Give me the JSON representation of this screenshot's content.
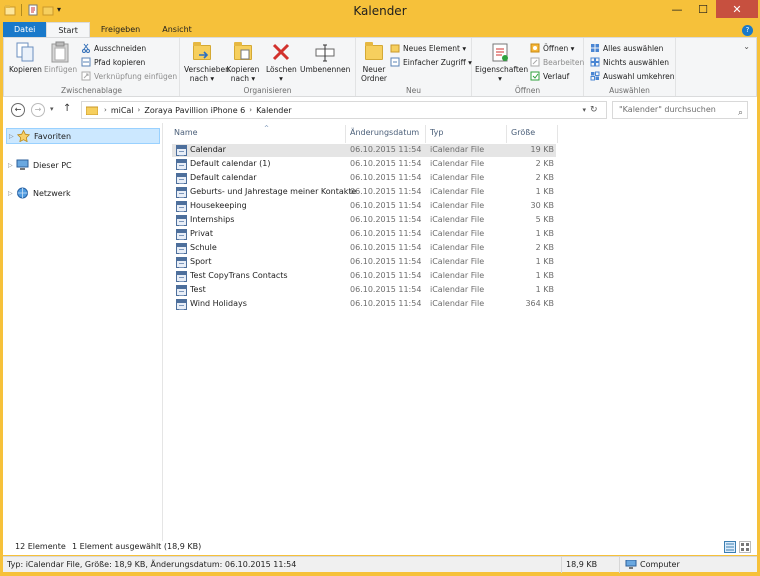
{
  "window": {
    "title": "Kalender",
    "minimize": "—",
    "maximize": "☐",
    "close": "✕"
  },
  "tabs": [
    {
      "label": "Datei"
    },
    {
      "label": "Start"
    },
    {
      "label": "Freigeben"
    },
    {
      "label": "Ansicht"
    }
  ],
  "ribbon": {
    "clipboard": {
      "label": "Zwischenablage",
      "copy": "Kopieren",
      "paste": "Einfügen",
      "cut": "Ausschneiden",
      "copy_path": "Pfad kopieren",
      "paste_shortcut": "Verknüpfung einfügen"
    },
    "organize": {
      "label": "Organisieren",
      "move_to_1": "Verschieben",
      "move_to_2": "nach",
      "copy_to_1": "Kopieren",
      "copy_to_2": "nach",
      "delete": "Löschen",
      "rename": "Umbenennen"
    },
    "new": {
      "label": "Neu",
      "new_folder_1": "Neuer",
      "new_folder_2": "Ordner",
      "new_item": "Neues Element",
      "easy_access": "Einfacher Zugriff"
    },
    "open": {
      "label": "Öffnen",
      "properties": "Eigenschaften",
      "open": "Öffnen",
      "edit": "Bearbeiten",
      "history": "Verlauf"
    },
    "select": {
      "label": "Auswählen",
      "select_all": "Alles auswählen",
      "select_none": "Nichts auswählen",
      "invert": "Auswahl umkehren"
    }
  },
  "address": {
    "crumbs": [
      "miCal",
      "Zoraya Pavillion iPhone 6",
      "Kalender"
    ],
    "search_placeholder": "\"Kalender\" durchsuchen"
  },
  "nav": {
    "items": [
      {
        "label": "Favoriten"
      },
      {
        "label": "Dieser PC"
      },
      {
        "label": "Netzwerk"
      }
    ]
  },
  "columns": {
    "name": "Name",
    "date": "Änderungsdatum",
    "type": "Typ",
    "size": "Größe"
  },
  "files": [
    {
      "name": "Calendar",
      "date": "06.10.2015 11:54",
      "type": "iCalendar File",
      "size": "19 KB",
      "selected": true
    },
    {
      "name": "Default calendar (1)",
      "date": "06.10.2015 11:54",
      "type": "iCalendar File",
      "size": "2 KB"
    },
    {
      "name": "Default calendar",
      "date": "06.10.2015 11:54",
      "type": "iCalendar File",
      "size": "2 KB"
    },
    {
      "name": "Geburts- und Jahrestage meiner Kontakte",
      "date": "06.10.2015 11:54",
      "type": "iCalendar File",
      "size": "1 KB"
    },
    {
      "name": "Housekeeping",
      "date": "06.10.2015 11:54",
      "type": "iCalendar File",
      "size": "30 KB"
    },
    {
      "name": "Internships",
      "date": "06.10.2015 11:54",
      "type": "iCalendar File",
      "size": "5 KB"
    },
    {
      "name": "Privat",
      "date": "06.10.2015 11:54",
      "type": "iCalendar File",
      "size": "1 KB"
    },
    {
      "name": "Schule",
      "date": "06.10.2015 11:54",
      "type": "iCalendar File",
      "size": "2 KB"
    },
    {
      "name": "Sport",
      "date": "06.10.2015 11:54",
      "type": "iCalendar File",
      "size": "1 KB"
    },
    {
      "name": "Test CopyTrans Contacts",
      "date": "06.10.2015 11:54",
      "type": "iCalendar File",
      "size": "1 KB"
    },
    {
      "name": "Test",
      "date": "06.10.2015 11:54",
      "type": "iCalendar File",
      "size": "1 KB"
    },
    {
      "name": "Wind Holidays",
      "date": "06.10.2015 11:54",
      "type": "iCalendar File",
      "size": "364 KB"
    }
  ],
  "status": {
    "count": "12 Elemente",
    "selection": "1 Element ausgewählt (18,9 KB)"
  },
  "details": {
    "info": "Typ: iCalendar File, Größe: 18,9 KB, Änderungsdatum: 06.10.2015 11:54",
    "size": "18,9 KB",
    "location": "Computer"
  },
  "colors": {
    "accent": "#1979ca",
    "titlebar": "#f6c13a",
    "selection": "#cce8ff"
  }
}
